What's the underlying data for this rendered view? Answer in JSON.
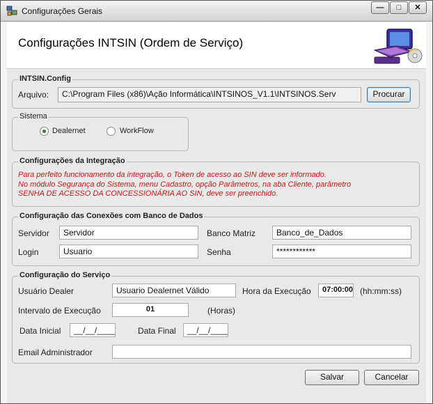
{
  "window": {
    "title": "Configurações Gerais",
    "header_title": "Configurações INTSIN (Ordem de Serviço)",
    "controls": {
      "minimize": "—",
      "maximize": "□",
      "close": "✕"
    }
  },
  "intsin_config": {
    "group_label": "INTSIN.Config",
    "arquivo_label": "Arquivo:",
    "arquivo_value": "C:\\Program Files (x86)\\Ação Informática\\INTSINOS_V1.1\\INTSINOS.Serv",
    "procurar_label": "Procurar"
  },
  "sistema": {
    "group_label": "Sistema",
    "options": [
      {
        "label": "Dealernet",
        "checked": true
      },
      {
        "label": "WorkFlow",
        "checked": false
      }
    ]
  },
  "integracao": {
    "group_label": "Configurações da Integração",
    "warning_lines": [
      "Para perfeito funcionamento da integração, o Token de acesso ao SIN deve ser informado.",
      "No módulo Segurança do Sistema, menu Cadastro, opção Parâmetros, na aba Cliente, parâmetro",
      "SENHA DE ACESSO DA CONCESSIONÁRIA AO SIN, deve ser preenchido."
    ],
    "warning_color": "#d11515"
  },
  "conexoes": {
    "group_label": "Configuração das Conexões com Banco de Dados",
    "servidor_label": "Servidor",
    "servidor_value": "Servidor",
    "banco_label": "Banco Matriz",
    "banco_value": "Banco_de_Dados",
    "login_label": "Login",
    "login_value": "Usuario",
    "senha_label": "Senha",
    "senha_value": "************"
  },
  "servico": {
    "group_label": "Configuração do Serviço",
    "usuario_label": "Usuário Dealer",
    "usuario_value": "Usuario Dealernet Válido",
    "hora_label": "Hora da Execução",
    "hora_value": "07:00:00",
    "hora_format": "(hh:mm:ss)",
    "intervalo_label": "Intervalo de Execução",
    "intervalo_value": "01",
    "intervalo_unit": "(Horas)",
    "data_inicial_label": "Data Inicial",
    "data_inicial_value": "__/__/____",
    "data_final_label": "Data Final",
    "data_final_value": "__/__/____",
    "email_label": "Email Administrador",
    "email_value": ""
  },
  "footer": {
    "salvar_label": "Salvar",
    "cancelar_label": "Cancelar"
  }
}
